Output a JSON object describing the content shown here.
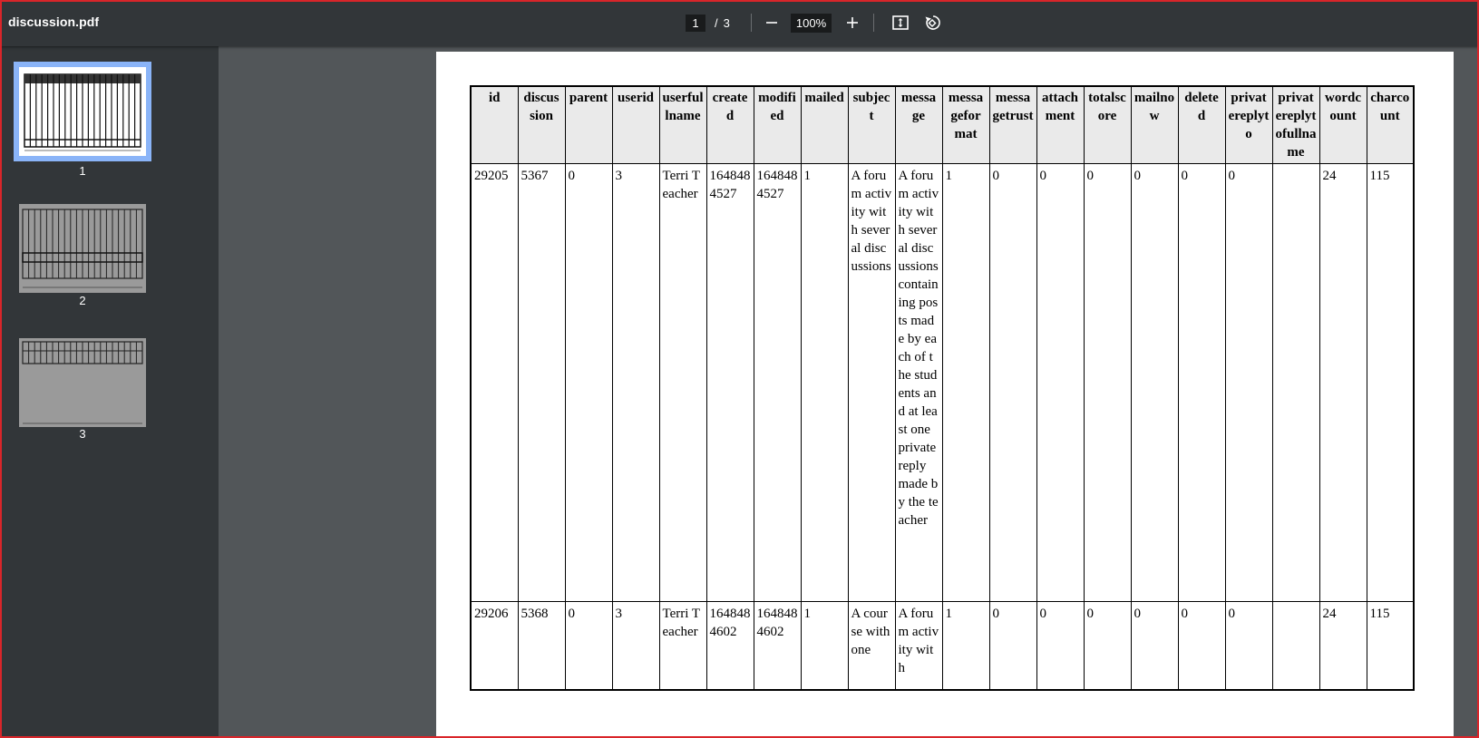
{
  "toolbar": {
    "title": "discussion.pdf",
    "current_page": "1",
    "page_separator": "/",
    "total_pages": "3",
    "zoom": "100%"
  },
  "sidebar": {
    "thumbnails": [
      {
        "label": "1"
      },
      {
        "label": "2"
      },
      {
        "label": "3"
      }
    ]
  },
  "table": {
    "headers": [
      "id",
      "discussion",
      "parent",
      "userid",
      "userfullname",
      "created",
      "modified",
      "mailed",
      "subject",
      "message",
      "messageformat",
      "messagetrust",
      "attachment",
      "totalscore",
      "mailnow",
      "deleted",
      "privatereplyto",
      "privatereplytofullname",
      "wordcount",
      "charcount"
    ],
    "rows": [
      [
        "29205",
        "5367",
        "0",
        "3",
        "Terri Teacher",
        "1648484527",
        "1648484527",
        "1",
        "A forum activity with several discussions",
        "A forum activity with several discussions containing posts made by each of the students and at least one private reply made by the teacher",
        "1",
        "0",
        "0",
        "0",
        "0",
        "0",
        "0",
        "",
        "24",
        "115"
      ],
      [
        "29206",
        "5368",
        "0",
        "3",
        "Terri Teacher",
        "1648484602",
        "1648484602",
        "1",
        "A course with one",
        "A forum activity with",
        "1",
        "0",
        "0",
        "0",
        "0",
        "0",
        "0",
        "",
        "24",
        "115"
      ]
    ]
  },
  "colors": {
    "toolbar_bg": "#323639",
    "viewer_bg": "#525659",
    "active_thumb_border": "#8ab4f8",
    "header_bg": "#eaeaea"
  },
  "icons": {
    "zoom_out": "minus-icon",
    "zoom_in": "plus-icon",
    "fit": "fit-to-page-icon",
    "rotate": "rotate-icon"
  }
}
